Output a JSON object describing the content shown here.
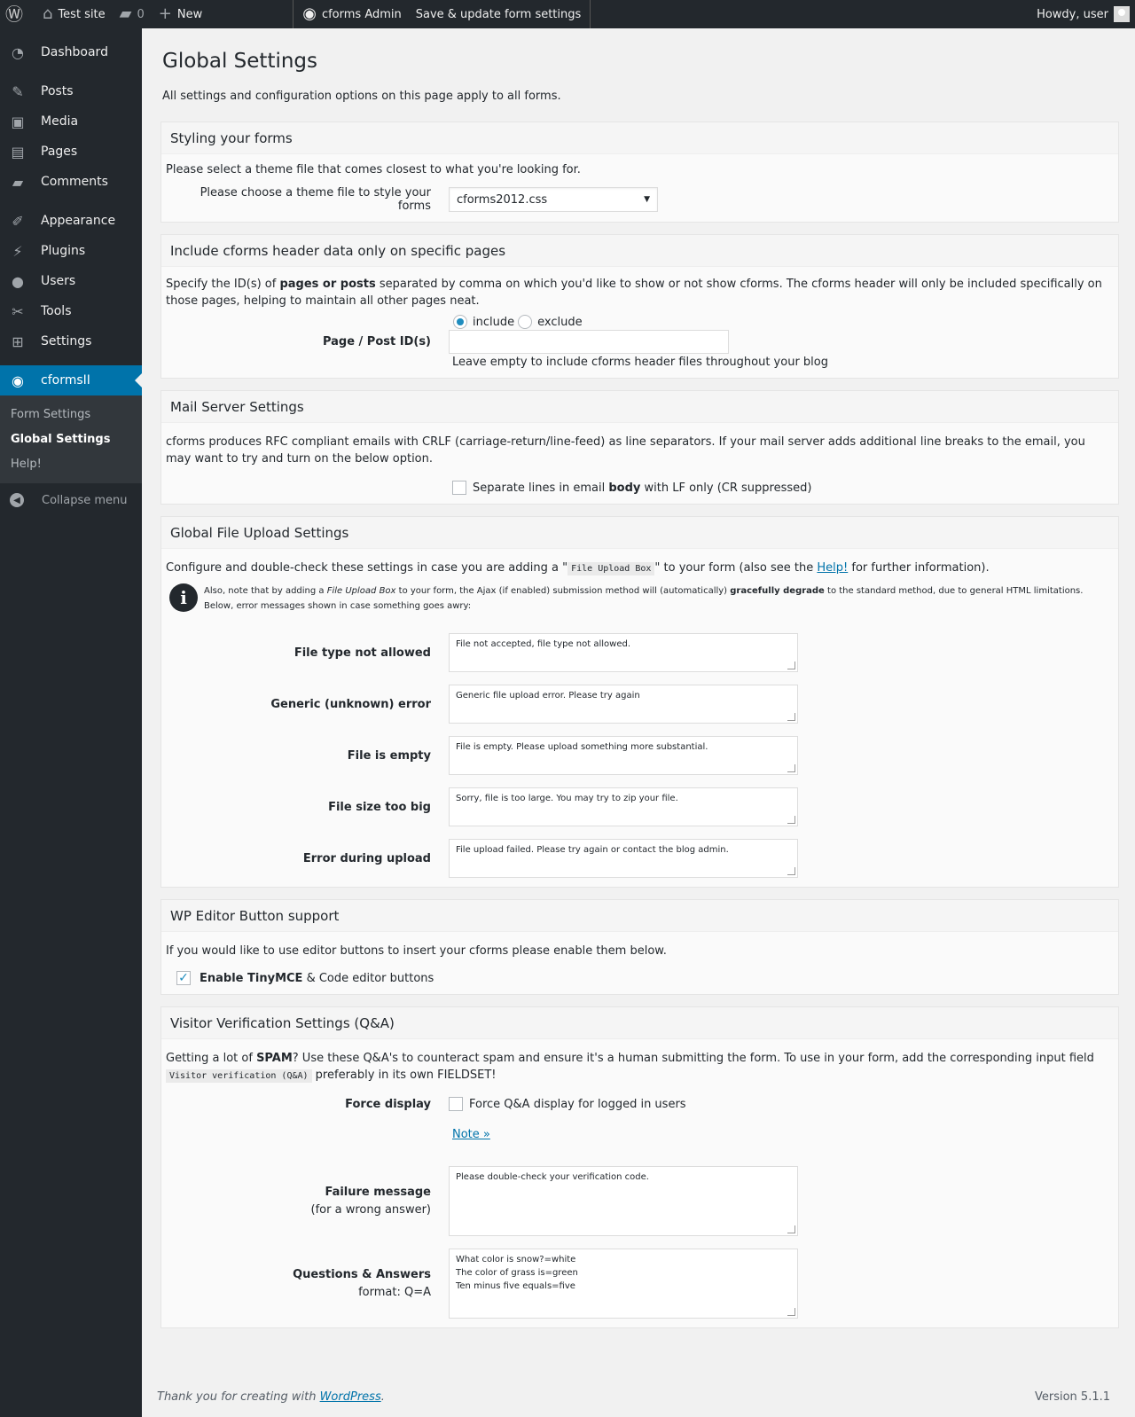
{
  "adminbar": {
    "site": "Test site",
    "comments_count": "0",
    "new_label": "New",
    "plugin_label": "cforms Admin",
    "save_label": "Save & update form settings",
    "howdy": "Howdy, user"
  },
  "sidebar": {
    "items": [
      {
        "label": "Dashboard"
      },
      {
        "label": "Posts"
      },
      {
        "label": "Media"
      },
      {
        "label": "Pages"
      },
      {
        "label": "Comments"
      },
      {
        "label": "Appearance"
      },
      {
        "label": "Plugins"
      },
      {
        "label": "Users"
      },
      {
        "label": "Tools"
      },
      {
        "label": "Settings"
      },
      {
        "label": "cformsII"
      }
    ],
    "submenu": [
      "Form Settings",
      "Global Settings",
      "Help!"
    ],
    "collapse": "Collapse menu"
  },
  "page": {
    "title": "Global Settings",
    "intro": "All settings and configuration options on this page apply to all forms."
  },
  "styling": {
    "title": "Styling your forms",
    "desc": "Please select a theme file that comes closest to what you're looking for.",
    "label": "Please choose a theme file to style your forms",
    "selected": "cforms2012.css"
  },
  "header_data": {
    "title": "Include cforms header data only on specific pages",
    "desc_1": "Specify the ID(s) of ",
    "desc_bold": "pages or posts",
    "desc_2": " separated by comma on which you'd like to show or not show cforms. The cforms header will only be included specifically on those pages, helping to maintain all other pages neat.",
    "include": "include",
    "exclude": "exclude",
    "label": "Page / Post ID(s)",
    "hint": "Leave empty to include cforms header files throughout your blog"
  },
  "mail": {
    "title": "Mail Server Settings",
    "desc": "cforms produces RFC compliant emails with CRLF (carriage-return/line-feed) as line separators. If your mail server adds additional line breaks to the email, you may want to try and turn on the below option.",
    "check_1": "Separate lines in email ",
    "check_bold": "body",
    "check_2": " with LF only (CR suppressed)"
  },
  "upload": {
    "title": "Global File Upload Settings",
    "desc_1": "Configure and double-check these settings in case you are adding a \"",
    "desc_code": "File Upload Box",
    "desc_2": "\" to your form (also see the ",
    "desc_link": "Help!",
    "desc_3": " for further information).",
    "note_1": "Also, note that by adding a ",
    "note_em": "File Upload Box",
    "note_2": " to your form, the Ajax (if enabled) submission method will (automatically) ",
    "note_bold": "gracefully degrade",
    "note_3": " to the standard method, due to general HTML limitations. Below, error messages shown in case something goes awry:",
    "fields": [
      {
        "label": "File type not allowed",
        "value": "File not accepted, file type not allowed."
      },
      {
        "label": "Generic (unknown) error",
        "value": "Generic file upload error. Please try again"
      },
      {
        "label": "File is empty",
        "value": "File is empty. Please upload something more substantial."
      },
      {
        "label": "File size too big",
        "value": "Sorry, file is too large. You may try to zip your file."
      },
      {
        "label": "Error during upload",
        "value": "File upload failed. Please try again or contact the blog admin."
      }
    ]
  },
  "editor": {
    "title": "WP Editor Button support",
    "desc": "If you would like to use editor buttons to insert your cforms please enable them below.",
    "check_bold": "Enable TinyMCE",
    "check_rest": " & Code editor buttons"
  },
  "qa": {
    "title": "Visitor Verification Settings (Q&A)",
    "desc_1": "Getting a lot of ",
    "desc_bold": "SPAM",
    "desc_2": "? Use these Q&A's to counteract spam and ensure it's a human submitting the form. To use in your form, add the corresponding input field ",
    "desc_code": "Visitor verification (Q&A)",
    "desc_3": " preferably in its own FIELDSET!",
    "force_label": "Force display",
    "force_check": "Force Q&A display for logged in users",
    "note_link": "Note »",
    "fail_label": "Failure message",
    "fail_sub": "(for a wrong answer)",
    "fail_value": "Please double-check your verification code.",
    "qa_label": "Questions & Answers",
    "qa_sub": "format: Q=A",
    "qa_value": "What color is snow?=white\nThe color of grass is=green\nTen minus five equals=five"
  },
  "footer": {
    "thanks": "Thank you for creating with ",
    "wp_link": "WordPress",
    "dot": ".",
    "version": "Version 5.1.1"
  }
}
